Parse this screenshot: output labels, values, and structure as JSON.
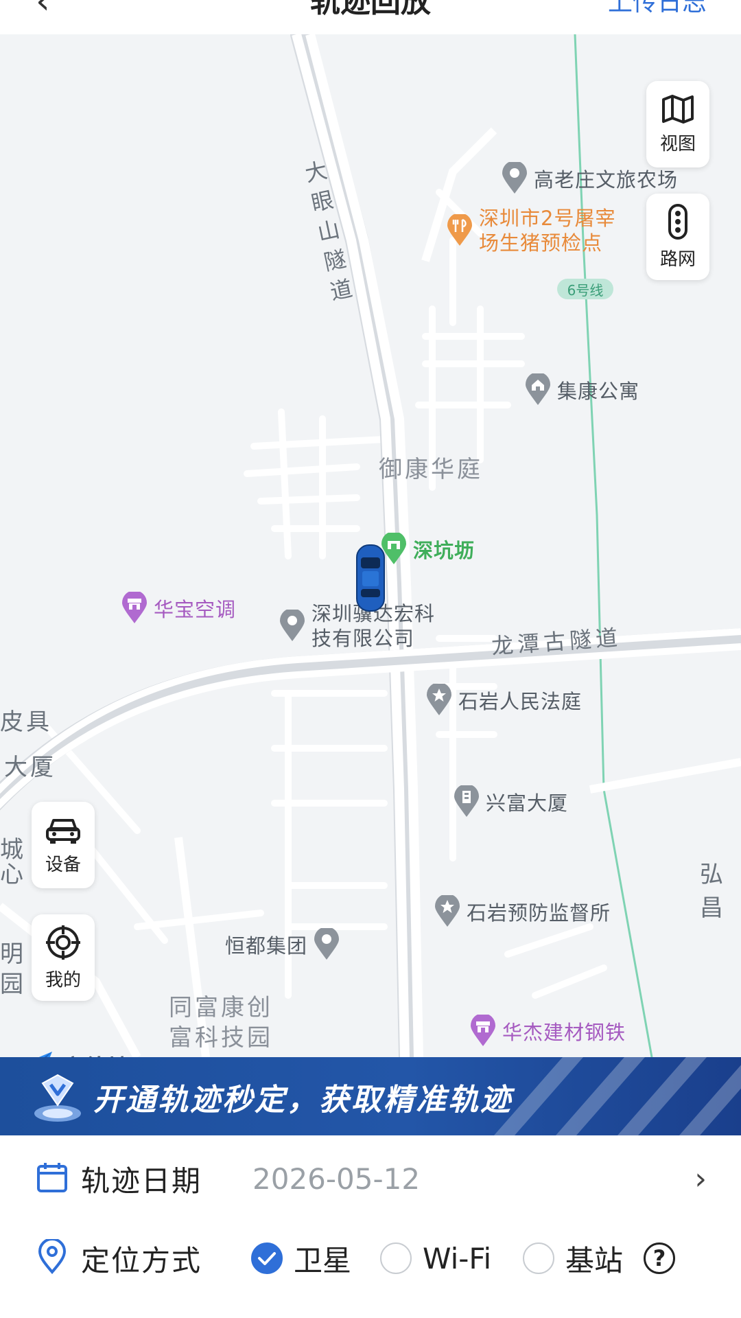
{
  "header": {
    "back_icon": "chevron-left-icon",
    "title": "轨迹回放",
    "action": "上传日志"
  },
  "map": {
    "road_labels": {
      "tunnel_vertical": [
        "大",
        "眼",
        "山",
        "隧",
        "道"
      ],
      "tunnel_horizontal": "龙潭古隧道"
    },
    "area_labels": {
      "yukang": "御康华庭",
      "tongfu_1": "同富康创",
      "tongfu_2": "富科技园",
      "left_a": "皮具",
      "left_b": "大厦",
      "left_c": "城",
      "left_d": "心",
      "left_e": "明",
      "left_f": "园",
      "right_a": "弘昌"
    },
    "pois": {
      "gaolaozhuang": "高老庄文旅农场",
      "shenzhen_slaughter_1": "深圳市2号屠宰",
      "shenzhen_slaughter_2": "场生猪预检点",
      "jikang": "集康公寓",
      "shenkengfang": "深坑坜",
      "huabao": "华宝空调",
      "jidahong_1": "深圳骥达宏科",
      "jidahong_2": "技有限公司",
      "shiyan_court": "石岩人民法庭",
      "xingfu": "兴富大厦",
      "shiyan_prevention": "石岩预防监督所",
      "hengdu": "恒都集团",
      "huajie": "华杰建材钢铁"
    },
    "metro_badge": "6号线",
    "controls": {
      "view": "视图",
      "road": "路网",
      "device": "设备",
      "mine": "我的"
    },
    "logo": "高德地图"
  },
  "banner": {
    "text": "开通轨迹秒定，获取精准轨迹",
    "icon": "diamond-vip-icon"
  },
  "panel": {
    "date_label": "轨迹日期",
    "date_value": "2026-05-12",
    "method_label": "定位方式",
    "options": {
      "satellite": "卫星",
      "wifi": "Wi-Fi",
      "station": "基站"
    },
    "selected": "卫星",
    "help": "?"
  },
  "colors": {
    "accent": "#2f6fd8",
    "banner": "#1d4f9c"
  }
}
